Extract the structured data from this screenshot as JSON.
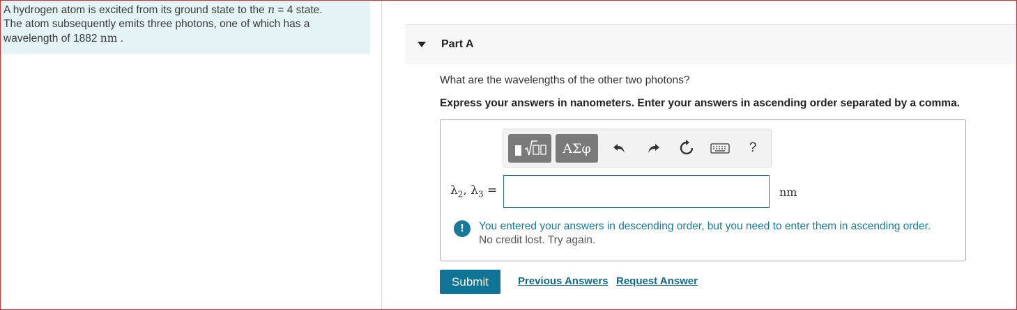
{
  "problem": {
    "line1_prefix": "A hydrogen atom is excited from its ground state to the ",
    "n_symbol": "n",
    "line1_suffix": " = 4 state.",
    "line2": "The atom subsequently emits three photons, one of which has a",
    "line3_prefix": "wavelength of 1882 ",
    "line3_unit": "nm",
    "line3_suffix": " ."
  },
  "part": {
    "title": "Part A"
  },
  "question": "What are the wavelengths of the other two photons?",
  "instruction": "Express your answers in nanometers. Enter your answers in ascending order separated by a comma.",
  "toolbar": {
    "greek_label": "ΑΣφ",
    "help_label": "?",
    "icons": [
      "templates-icon",
      "greek-symbols-icon",
      "undo-icon",
      "redo-icon",
      "reset-icon",
      "keyboard-icon",
      "help-icon"
    ]
  },
  "answer": {
    "label_lambda_a": "λ",
    "label_sub_a": "2",
    "label_sep": ", ",
    "label_lambda_b": "λ",
    "label_sub_b": "3",
    "label_eq": " =",
    "value": "",
    "unit": "nm"
  },
  "feedback": {
    "icon": "!",
    "message": "You entered your answers in descending order, but you need to enter them in ascending order.",
    "note": "No credit lost. Try again."
  },
  "actions": {
    "submit": "Submit",
    "previous_answers": "Previous Answers",
    "request_answer": "Request Answer"
  },
  "colors": {
    "accent": "#0f7495",
    "problem_bg": "#e4f4f6",
    "feedback": "#157a9c",
    "frame_border": "#d32f2f"
  }
}
